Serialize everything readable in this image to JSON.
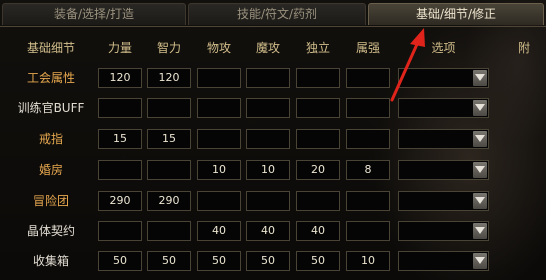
{
  "tabs": [
    {
      "label": "装备/选择/打造"
    },
    {
      "label": "技能/符文/药剂"
    },
    {
      "label": "基础/细节/修正"
    }
  ],
  "columns": {
    "rowhead": "基础细节",
    "c1": "力量",
    "c2": "智力",
    "c3": "物攻",
    "c4": "魔攻",
    "c5": "独立",
    "c6": "属强",
    "c7": "选项",
    "c8": "附"
  },
  "rows": [
    {
      "label": "工会属性",
      "color": "#e7a84f",
      "values": [
        "120",
        "120",
        "",
        "",
        "",
        ""
      ]
    },
    {
      "label": "训练官BUFF",
      "color": "#e2ddd2",
      "values": [
        "",
        "",
        "",
        "",
        "",
        ""
      ]
    },
    {
      "label": "戒指",
      "color": "#e7a84f",
      "values": [
        "15",
        "15",
        "",
        "",
        "",
        ""
      ]
    },
    {
      "label": "婚房",
      "color": "#e7a84f",
      "values": [
        "",
        "",
        "10",
        "10",
        "20",
        "8"
      ]
    },
    {
      "label": "冒险团",
      "color": "#e7a84f",
      "values": [
        "290",
        "290",
        "",
        "",
        "",
        ""
      ]
    },
    {
      "label": "晶体契约",
      "color": "#e2ddd2",
      "values": [
        "",
        "",
        "40",
        "40",
        "40",
        ""
      ]
    },
    {
      "label": "收集箱",
      "color": "#e2ddd2",
      "values": [
        "50",
        "50",
        "50",
        "50",
        "50",
        "10"
      ]
    }
  ],
  "icons": {
    "dropdown": "chevron-down-icon",
    "annotation": "red-arrow-annotation"
  },
  "colors": {
    "annotation": "#e0241b",
    "accent_label": "#e7a84f"
  }
}
